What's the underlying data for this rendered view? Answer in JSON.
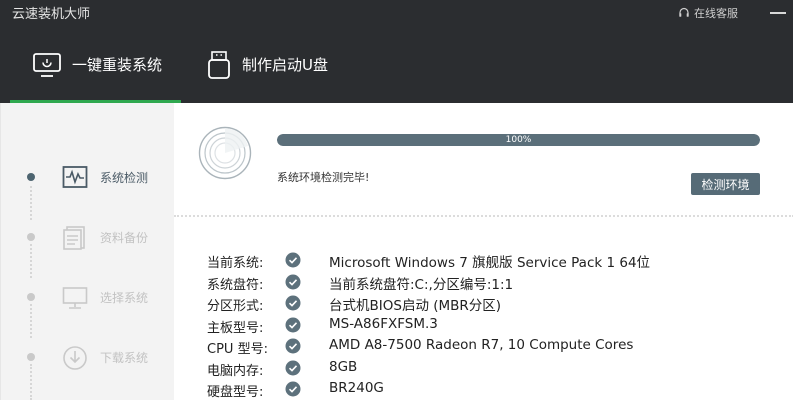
{
  "app": {
    "title": "云速装机大师",
    "support_label": "在线客服"
  },
  "tabs": [
    {
      "label": "一键重装系统",
      "icon": "monitor-icon",
      "active": true
    },
    {
      "label": "制作启动U盘",
      "icon": "usb-drive-icon",
      "active": false
    }
  ],
  "steps": [
    {
      "label": "系统检测",
      "icon": "pulse-monitor-icon",
      "active": true
    },
    {
      "label": "资料备份",
      "icon": "document-icon",
      "active": false
    },
    {
      "label": "选择系统",
      "icon": "monitor-icon",
      "active": false
    },
    {
      "label": "下载系统",
      "icon": "download-icon",
      "active": false
    }
  ],
  "progress": {
    "percent": 100,
    "label": "100%",
    "status": "系统环境检测完毕!"
  },
  "buttons": {
    "check_env": "检测环境"
  },
  "system_info": [
    {
      "key": "当前系统:",
      "value": "Microsoft Windows 7 旗舰版 Service Pack 1 64位"
    },
    {
      "key": "系统盘符:",
      "value": "当前系统盘符:C:,分区编号:1:1"
    },
    {
      "key": "分区形式:",
      "value": "台式机BIOS启动 (MBR分区)"
    },
    {
      "key": "主板型号:",
      "value": "MS-A86FXFSM.3"
    },
    {
      "key": "CPU 型号:",
      "value": "AMD A8-7500 Radeon R7, 10 Compute Cores"
    },
    {
      "key": "电脑内存:",
      "value": "8GB"
    },
    {
      "key": "硬盘型号:",
      "value": "BR240G"
    }
  ],
  "colors": {
    "accent_green": "#2fa84f",
    "slate": "#566b77",
    "titlebar": "#2b2d30"
  }
}
